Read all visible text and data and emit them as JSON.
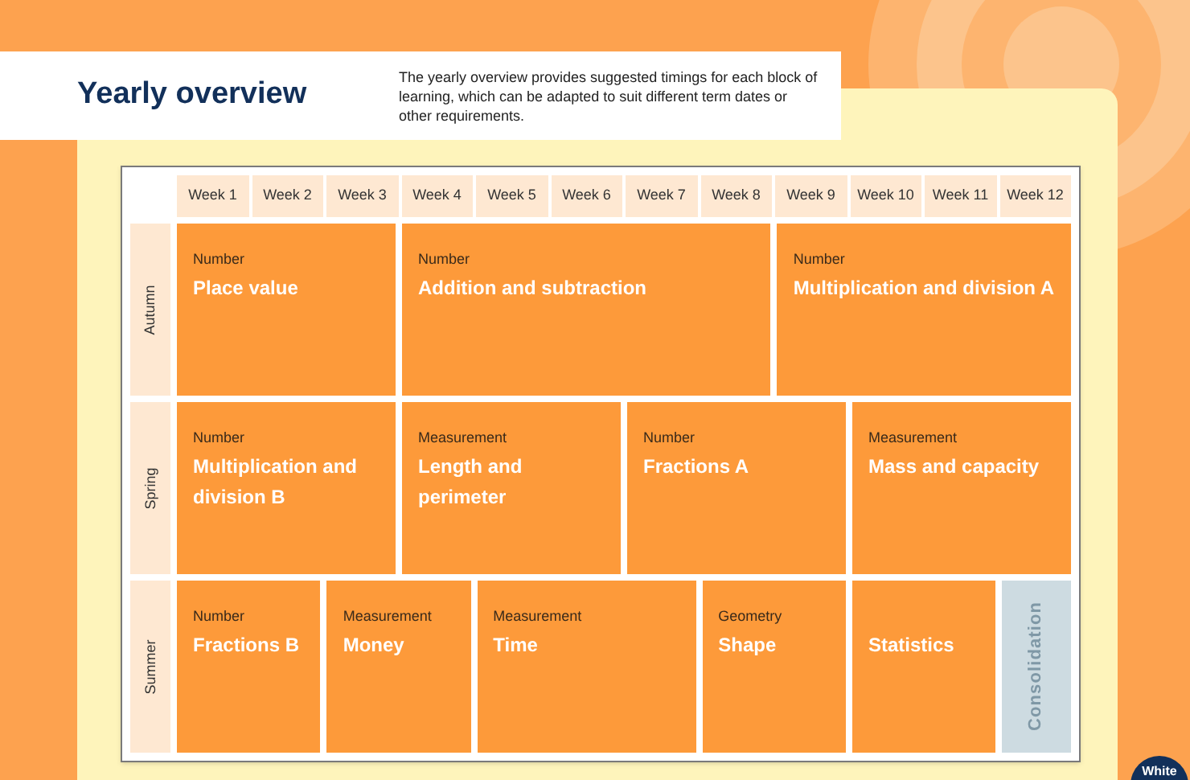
{
  "header": {
    "title": "Yearly overview",
    "description": "The yearly overview provides suggested timings for each block of learning, which can be adapted to suit different term dates or other requirements."
  },
  "weeks": [
    "Week 1",
    "Week 2",
    "Week 3",
    "Week 4",
    "Week 5",
    "Week 6",
    "Week 7",
    "Week 8",
    "Week 9",
    "Week 10",
    "Week 11",
    "Week 12"
  ],
  "terms": [
    {
      "name": "Autumn",
      "blocks": [
        {
          "kind": "triple",
          "category": "Number",
          "title": "Place value"
        },
        {
          "kind": "quintuple",
          "category": "Number",
          "title": "Addition and subtraction"
        },
        {
          "kind": "quadruple",
          "category": "Number",
          "title": "Multiplication and division A"
        }
      ]
    },
    {
      "name": "Spring",
      "blocks": [
        {
          "kind": "triple",
          "category": "Number",
          "title": "Multiplication and division B"
        },
        {
          "kind": "triple",
          "category": "Measurement",
          "title": "Length and perimeter"
        },
        {
          "kind": "triple",
          "category": "Number",
          "title": "Fractions A"
        },
        {
          "kind": "triple",
          "category": "Measurement",
          "title": "Mass and capacity"
        }
      ]
    },
    {
      "name": "Summer",
      "blocks": [
        {
          "kind": "double",
          "category": "Number",
          "title": "Fractions B"
        },
        {
          "kind": "double",
          "category": "Measurement",
          "title": "Money"
        },
        {
          "kind": "triple",
          "category": "Measurement",
          "title": "Time"
        },
        {
          "kind": "double",
          "category": "Geometry",
          "title": "Shape"
        },
        {
          "kind": "double",
          "title": "Statistics"
        },
        {
          "kind": "consolidation",
          "title": "Consolidation"
        }
      ]
    }
  ],
  "badge": "White"
}
